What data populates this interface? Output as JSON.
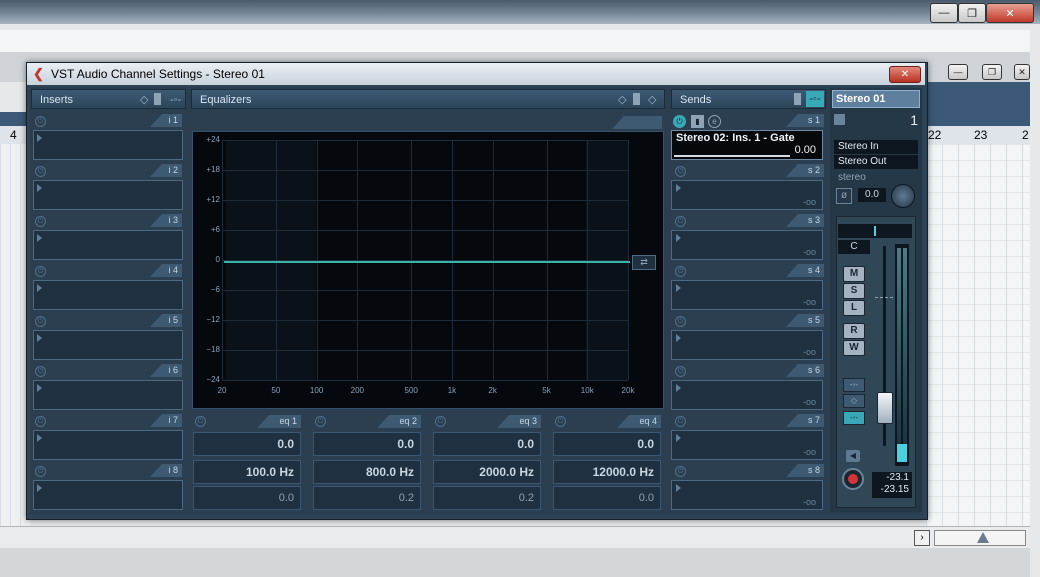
{
  "dialog": {
    "title": "VST Audio Channel Settings - Stereo 01",
    "close_label": "✕"
  },
  "host": {
    "ruler_left": "4",
    "ruler_right": [
      "22",
      "23",
      "2"
    ],
    "window_buttons": [
      "—",
      "❐",
      "✕"
    ]
  },
  "inserts": {
    "header": "Inserts",
    "slots": [
      {
        "tag": "i 1"
      },
      {
        "tag": "i 2"
      },
      {
        "tag": "i 3"
      },
      {
        "tag": "i 4"
      },
      {
        "tag": "i 5"
      },
      {
        "tag": "i 6"
      },
      {
        "tag": "i 7"
      },
      {
        "tag": "i 8"
      }
    ]
  },
  "equalizers": {
    "header": "Equalizers",
    "y_labels": [
      "+24",
      "+18",
      "+12",
      "+6",
      "0",
      "−6",
      "−12",
      "−18",
      "−24"
    ],
    "x_labels": [
      "20",
      "50",
      "100",
      "200",
      "500",
      "1k",
      "2k",
      "5k",
      "10k",
      "20k"
    ],
    "bands": [
      {
        "tag": "eq 1",
        "gain": "0.0",
        "freq": "100.0 Hz",
        "q": "0.0"
      },
      {
        "tag": "eq 2",
        "gain": "0.0",
        "freq": "800.0 Hz",
        "q": "0.2"
      },
      {
        "tag": "eq 3",
        "gain": "0.0",
        "freq": "2000.0 Hz",
        "q": "0.2"
      },
      {
        "tag": "eq 4",
        "gain": "0.0",
        "freq": "12000.0 Hz",
        "q": "0.0"
      }
    ]
  },
  "sends": {
    "header": "Sends",
    "slots": [
      {
        "tag": "s 1",
        "name": "Stereo 02: Ins. 1 - Gate",
        "value": "0.00"
      },
      {
        "tag": "s 2",
        "value": "-oo"
      },
      {
        "tag": "s 3",
        "value": "-oo"
      },
      {
        "tag": "s 4",
        "value": "-oo"
      },
      {
        "tag": "s 5",
        "value": "-oo"
      },
      {
        "tag": "s 6",
        "value": "-oo"
      },
      {
        "tag": "s 7",
        "value": "-oo"
      },
      {
        "tag": "s 8",
        "value": "-oo"
      }
    ]
  },
  "channel": {
    "name": "Stereo 01",
    "number": "1",
    "input": "Stereo In",
    "output": "Stereo Out",
    "config": "stereo",
    "phase_value": "0.0",
    "pan_label": "C",
    "buttons": [
      "M",
      "S",
      "L",
      "R",
      "W"
    ],
    "meter_top": "-23.1",
    "meter_bottom": "-23.15"
  },
  "colors": {
    "accent": "#2f4356",
    "eq_curve": "#38b4a8",
    "record": "#d9333a"
  }
}
